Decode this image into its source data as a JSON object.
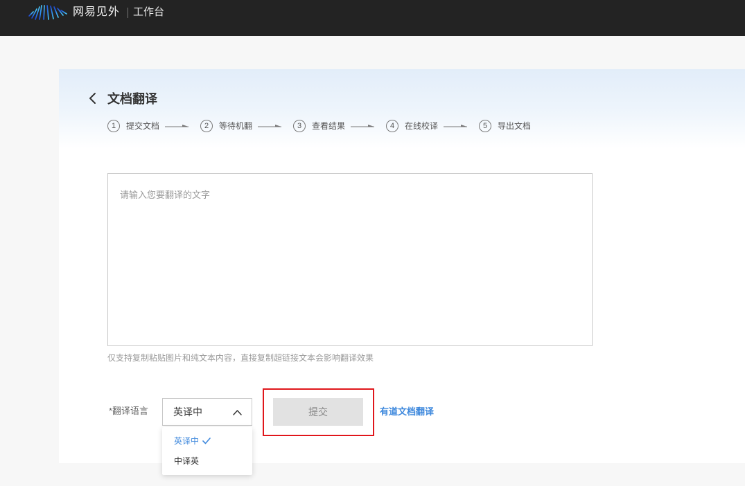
{
  "header": {
    "brand": "网易见外",
    "workspace": "工作台"
  },
  "page": {
    "title": "文档翻译"
  },
  "steps": [
    {
      "num": "1",
      "label": "提交文档"
    },
    {
      "num": "2",
      "label": "等待机翻"
    },
    {
      "num": "3",
      "label": "查看结果"
    },
    {
      "num": "4",
      "label": "在线校译"
    },
    {
      "num": "5",
      "label": "导出文档"
    }
  ],
  "editor": {
    "placeholder": "请输入您要翻译的文字",
    "value": ""
  },
  "hint": "仅支持复制粘贴图片和纯文本内容，直接复制超链接文本会影响翻译效果",
  "language": {
    "label": "*翻译语言",
    "selected": "英译中",
    "options": [
      {
        "label": "英译中",
        "selected": true
      },
      {
        "label": "中译英",
        "selected": false
      }
    ]
  },
  "submit_label": "提交",
  "youdao_link": "有道文档翻译",
  "icons": {
    "logo": "logo-icon",
    "back": "chevron-left-icon",
    "step_arrow": "arrow-right-icon",
    "select_toggle": "chevron-up-icon",
    "selected_mark": "check-icon"
  },
  "colors": {
    "header_bg": "#232323",
    "page_bg": "#f7f7f7",
    "accent": "#3f89dd",
    "button_disabled_bg": "#e2e2e2",
    "highlight": "#e0161b"
  }
}
